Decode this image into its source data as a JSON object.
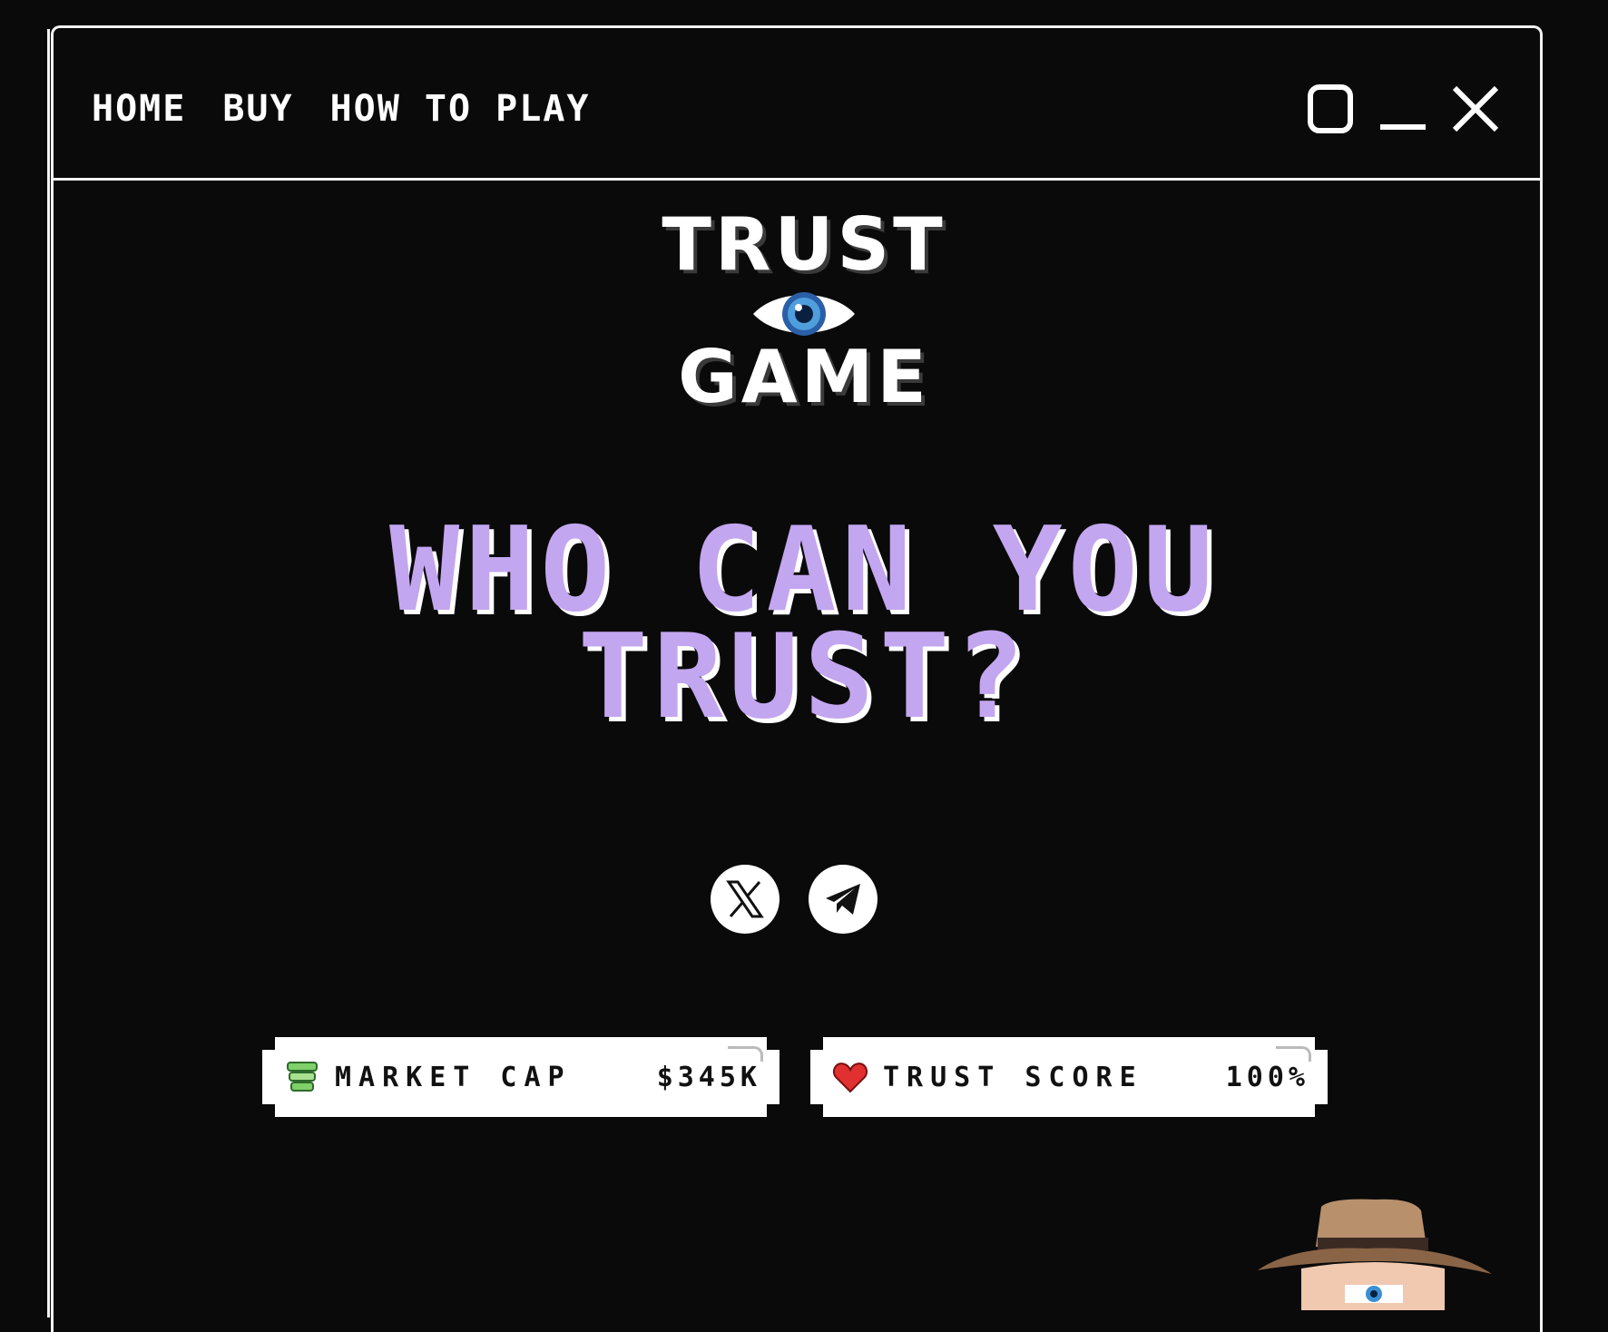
{
  "nav": {
    "items": [
      "HOME",
      "BUY",
      "HOW TO PLAY"
    ]
  },
  "window_controls": [
    "maximize-icon",
    "minimize-icon",
    "close-icon"
  ],
  "logo": {
    "top": "TRUST",
    "bottom": "GAME"
  },
  "headline": {
    "line1": "WHO CAN YOU",
    "line2": "TRUST?"
  },
  "socials": [
    {
      "name": "x-icon"
    },
    {
      "name": "telegram-icon"
    }
  ],
  "stats": {
    "market_cap": {
      "label": "MARKET CAP",
      "value": "$345K",
      "icon": "money-stack-icon"
    },
    "trust_score": {
      "label": "TRUST SCORE",
      "value": "100%",
      "icon": "heart-icon"
    }
  },
  "colors": {
    "background": "#0a0a0a",
    "headline": "#c3a6f0",
    "frame": "#f2f2f2"
  }
}
